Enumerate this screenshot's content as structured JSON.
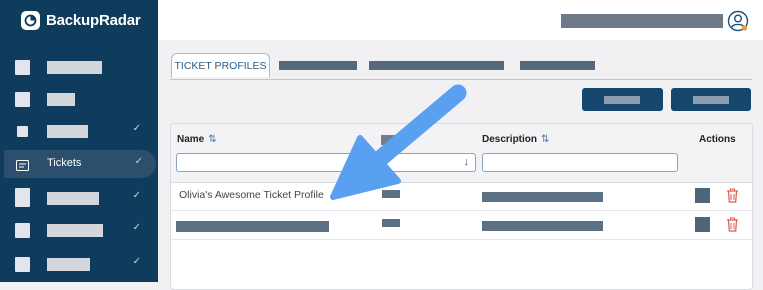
{
  "brand": {
    "name": "BackupRadar"
  },
  "sidebar": {
    "active_item": {
      "label": "Tickets"
    }
  },
  "tabs": [
    {
      "label": "TICKET PROFILES"
    }
  ],
  "table": {
    "headers": {
      "name": "Name",
      "description": "Description",
      "actions": "Actions"
    },
    "rows": [
      {
        "name": "Olivia's Awesome Ticket Profile"
      }
    ]
  },
  "colors": {
    "sidebar": "#0f3b5c",
    "primary": "#15476e",
    "accent_arrow": "#5aa0f0",
    "delete": "#e05a4f",
    "notification": "#f39c34"
  },
  "icons": [
    "radar-logo-icon",
    "ticket-icon",
    "chevron-down-icon",
    "user-icon",
    "sort-icon",
    "filter-arrow-icon",
    "trash-icon",
    "edit-icon",
    "annotation-arrow"
  ]
}
